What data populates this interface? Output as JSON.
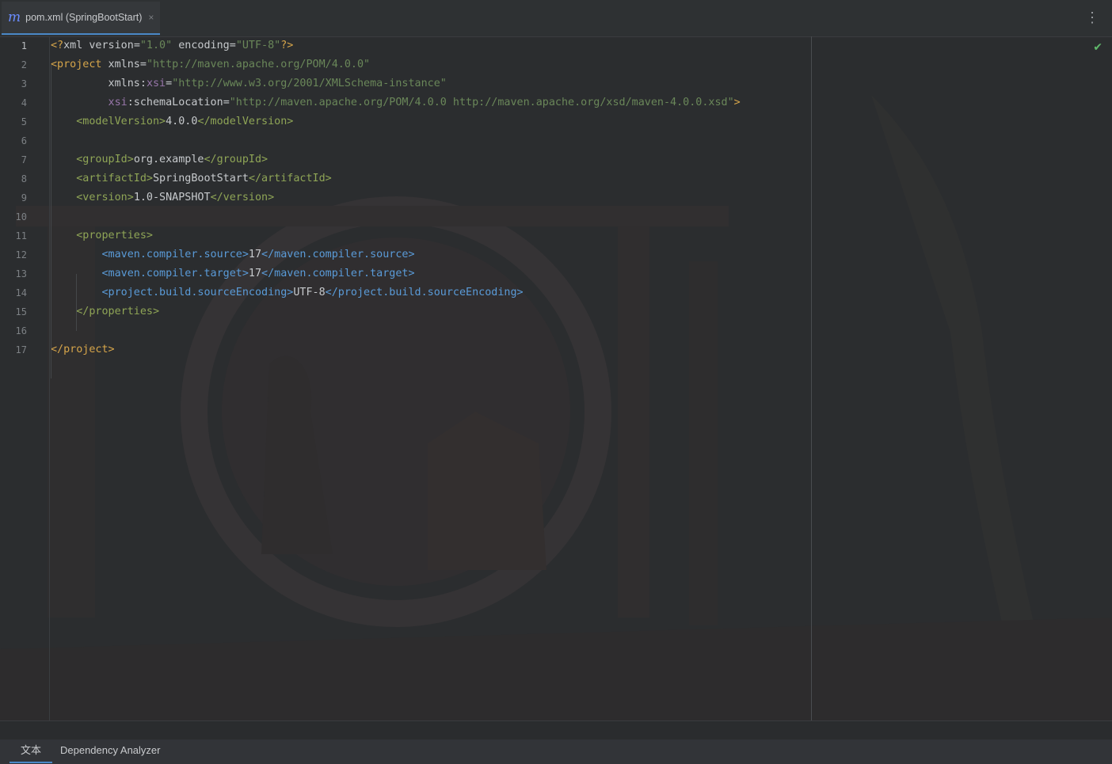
{
  "tab": {
    "icon": "m",
    "title": "pom.xml (SpringBootStart)",
    "close": "×"
  },
  "toolbar": {
    "more": "⋮"
  },
  "editor": {
    "status_icon": "check-icon",
    "current_line": 1,
    "line_numbers": [
      "1",
      "2",
      "3",
      "4",
      "5",
      "6",
      "7",
      "8",
      "9",
      "10",
      "11",
      "12",
      "13",
      "14",
      "15",
      "16",
      "17"
    ]
  },
  "code": [
    {
      "n": 1,
      "spans": [
        {
          "t": "<?",
          "c": "pi"
        },
        {
          "t": "xml version",
          "c": "attr"
        },
        {
          "t": "=",
          "c": "txt"
        },
        {
          "t": "\"1.0\"",
          "c": "str"
        },
        {
          "t": " encoding",
          "c": "attr"
        },
        {
          "t": "=",
          "c": "txt"
        },
        {
          "t": "\"UTF-8\"",
          "c": "str"
        },
        {
          "t": "?>",
          "c": "pi"
        }
      ]
    },
    {
      "n": 2,
      "spans": [
        {
          "t": "<project",
          "c": "tag"
        },
        {
          "t": " xmlns",
          "c": "attr"
        },
        {
          "t": "=",
          "c": "txt"
        },
        {
          "t": "\"http://maven.apache.org/POM/4.0.0\"",
          "c": "str"
        }
      ]
    },
    {
      "n": 3,
      "spans": [
        {
          "t": "         xmlns",
          "c": "attr"
        },
        {
          "t": ":",
          "c": "txt"
        },
        {
          "t": "xsi",
          "c": "ns"
        },
        {
          "t": "=",
          "c": "txt"
        },
        {
          "t": "\"http://www.w3.org/2001/XMLSchema-instance\"",
          "c": "str"
        }
      ]
    },
    {
      "n": 4,
      "spans": [
        {
          "t": "         xsi",
          "c": "ns"
        },
        {
          "t": ":schemaLocation",
          "c": "attr"
        },
        {
          "t": "=",
          "c": "txt"
        },
        {
          "t": "\"http://maven.apache.org/POM/4.0.0 http://maven.apache.org/xsd/maven-4.0.0.xsd\"",
          "c": "str"
        },
        {
          "t": ">",
          "c": "tag"
        }
      ]
    },
    {
      "n": 5,
      "spans": [
        {
          "t": "    <modelVersion>",
          "c": "dtag"
        },
        {
          "t": "4.0.0",
          "c": "txt"
        },
        {
          "t": "</modelVersion>",
          "c": "dtag"
        }
      ]
    },
    {
      "n": 6,
      "spans": []
    },
    {
      "n": 7,
      "spans": [
        {
          "t": "    <groupId>",
          "c": "dtag"
        },
        {
          "t": "org.example",
          "c": "txt"
        },
        {
          "t": "</groupId>",
          "c": "dtag"
        }
      ]
    },
    {
      "n": 8,
      "spans": [
        {
          "t": "    <artifactId>",
          "c": "dtag"
        },
        {
          "t": "SpringBootStart",
          "c": "txt"
        },
        {
          "t": "</artifactId>",
          "c": "dtag"
        }
      ]
    },
    {
      "n": 9,
      "spans": [
        {
          "t": "    <version>",
          "c": "dtag"
        },
        {
          "t": "1.0-SNAPSHOT",
          "c": "txt"
        },
        {
          "t": "</version>",
          "c": "dtag"
        }
      ]
    },
    {
      "n": 10,
      "spans": []
    },
    {
      "n": 11,
      "spans": [
        {
          "t": "    <properties>",
          "c": "dtag"
        }
      ]
    },
    {
      "n": 12,
      "spans": [
        {
          "t": "        <maven.compiler.source>",
          "c": "btag"
        },
        {
          "t": "17",
          "c": "txt"
        },
        {
          "t": "</maven.compiler.source>",
          "c": "btag"
        }
      ]
    },
    {
      "n": 13,
      "spans": [
        {
          "t": "        <maven.compiler.target>",
          "c": "btag"
        },
        {
          "t": "17",
          "c": "txt"
        },
        {
          "t": "</maven.compiler.target>",
          "c": "btag"
        }
      ]
    },
    {
      "n": 14,
      "spans": [
        {
          "t": "        <project.build.sourceEncoding>",
          "c": "btag"
        },
        {
          "t": "UTF-8",
          "c": "txt"
        },
        {
          "t": "</project.build.sourceEncoding>",
          "c": "btag"
        }
      ]
    },
    {
      "n": 15,
      "spans": [
        {
          "t": "    </properties>",
          "c": "dtag"
        }
      ]
    },
    {
      "n": 16,
      "spans": []
    },
    {
      "n": 17,
      "spans": [
        {
          "t": "</project>",
          "c": "tag"
        }
      ]
    }
  ],
  "bottom_tabs": [
    {
      "label": "文本",
      "active": true
    },
    {
      "label": "Dependency Analyzer",
      "active": false
    }
  ]
}
